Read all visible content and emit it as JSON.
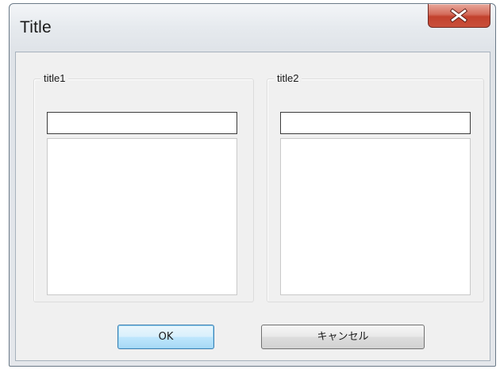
{
  "window": {
    "title": "Title",
    "close_label": "x"
  },
  "groups": [
    {
      "title": "title1",
      "input_value": "",
      "list_items": []
    },
    {
      "title": "title2",
      "input_value": "",
      "list_items": []
    }
  ],
  "buttons": {
    "ok_label": "OK",
    "cancel_label": "キャンセル"
  },
  "colors": {
    "close_button": "#c94f3a",
    "ok_button_border": "#3c7fb1",
    "client_background": "#f0f0f0"
  },
  "icons": {
    "close": "close-icon"
  }
}
